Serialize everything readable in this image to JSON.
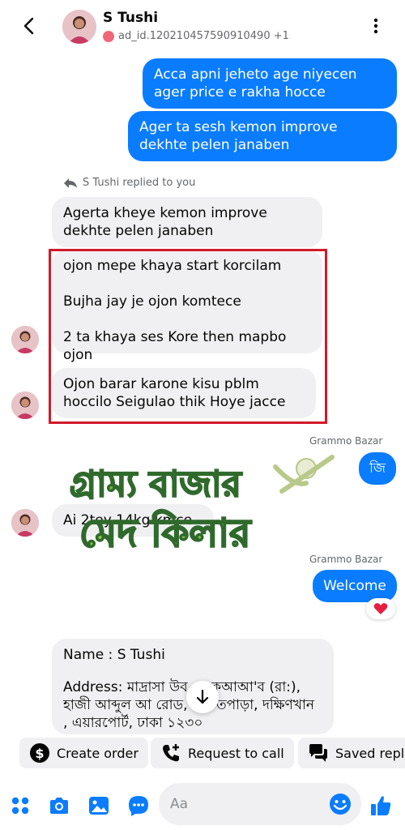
{
  "header": {
    "name": "S Tushi",
    "subtitle": "ad_id.120210457590910490 +1"
  },
  "messages": {
    "out_1": "Acca apni jeheto age niyecen ager price e rakha hocce",
    "out_2": "Ager ta sesh kemon improve dekhte pelen janaben",
    "reply_label": "S Tushi replied to you",
    "in_1": "Agerta kheye kemon improve dekhte pelen janaben",
    "in_2_line1": "ojon mepe khaya start korcilam",
    "in_2_line2": "Bujha jay je ojon komtece",
    "in_2_line3": "2 ta khaya ses Kore then mapbo ojon",
    "in_3": "Ojon barar karone kisu pblm hoccilo Seigulao thik Hoye jacce",
    "sender_1": "Grammo Bazar",
    "out_3": "জি",
    "in_4": "Ai 2tey 14kg kmce",
    "sender_2": "Grammo Bazar",
    "out_4": "Welcome",
    "reaction": "❤️",
    "in_5_name": "Name : S Tushi",
    "in_5_address": "Address: মাদ্রাসা উব          কে কআআ'ব (রা:), হাজী আব্দুল আ        রোড, পন্ডিতপাড়া, দক্ষিণখান , এয়ারপোর্ট, ঢাকা ১২৩০"
  },
  "watermark": {
    "line1": "গ্রাম্য বাজার",
    "line2": "মেদ কিলার"
  },
  "actions": {
    "create_order": "Create order",
    "request_call": "Request to call",
    "saved_replies": "Saved replies"
  },
  "composer": {
    "placeholder": "Aa"
  },
  "colors": {
    "accent": "#0a7cff",
    "incoming": "#f0f0f2",
    "highlight": "#d11a2a"
  }
}
